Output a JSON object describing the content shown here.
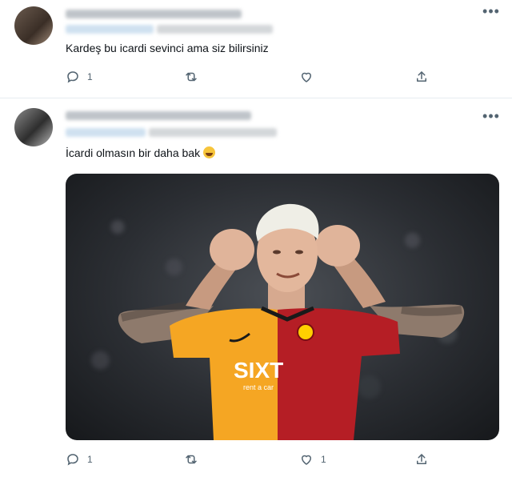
{
  "tweets": [
    {
      "text": "Kardeş bu icardi sevinci ama siz bilirsiniz",
      "reply_count": "1",
      "retweet_count": "",
      "like_count": ""
    },
    {
      "text": "İcardi olmasın bir daha bak",
      "reply_count": "1",
      "retweet_count": "",
      "like_count": "1",
      "media": {
        "sponsor_text": "SIXT",
        "sponsor_sub": "rent a car"
      }
    }
  ],
  "icons": {
    "more": "more-horizontal-icon",
    "reply": "reply-icon",
    "retweet": "retweet-icon",
    "like": "heart-icon",
    "share": "share-icon",
    "emoji": "tears-of-joy-emoji"
  },
  "colors": {
    "icon": "#536471",
    "text": "#0f1419",
    "divider": "#e6ecf0",
    "jersey_yellow": "#f5a623",
    "jersey_red": "#b51e25"
  }
}
